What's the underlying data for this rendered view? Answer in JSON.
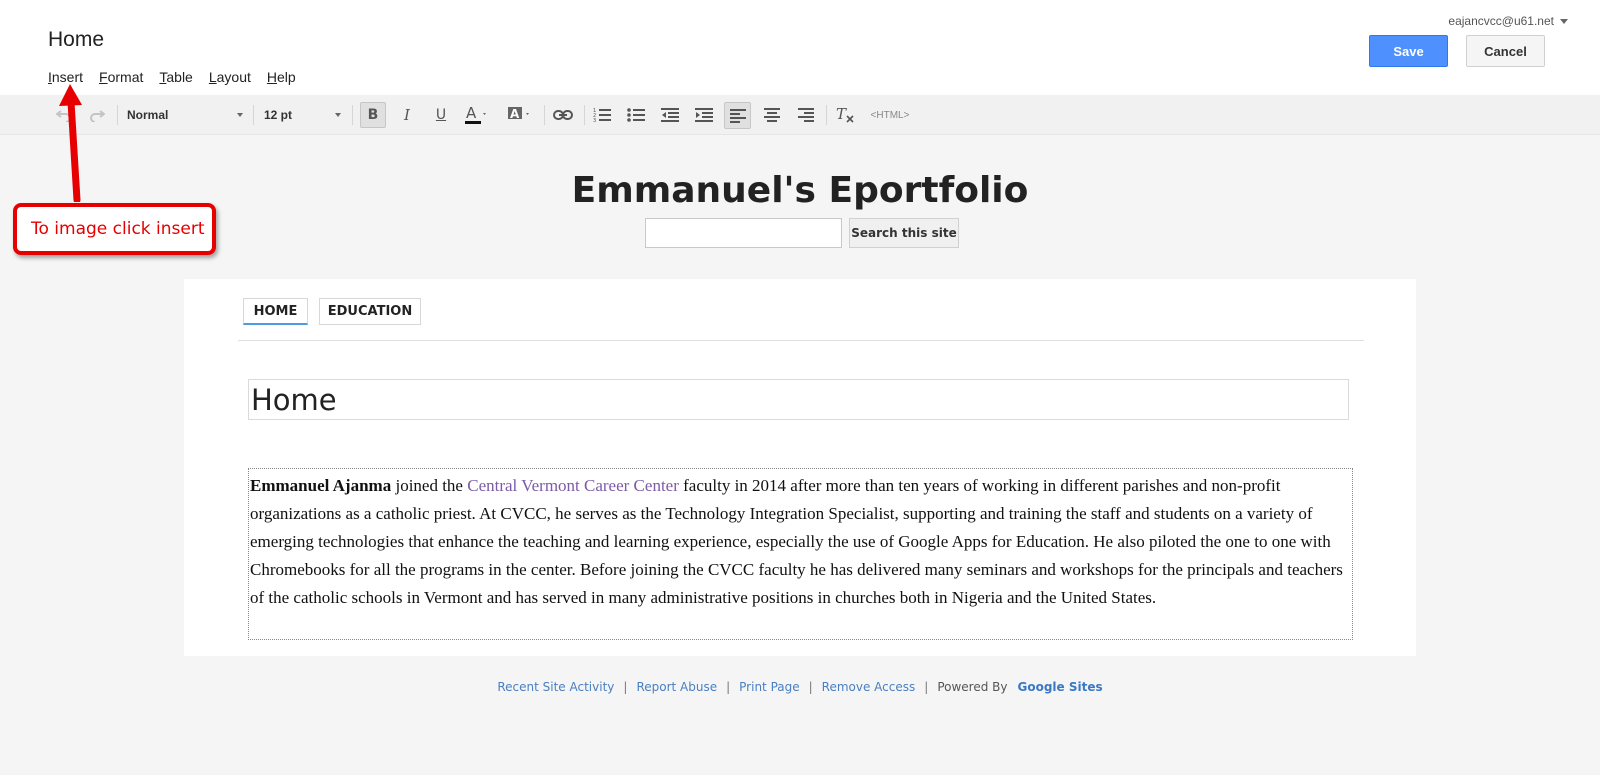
{
  "header": {
    "page_name": "Home",
    "account": "eajancvcc@u61.net",
    "save_label": "Save",
    "cancel_label": "Cancel"
  },
  "menu": {
    "items": [
      {
        "first": "I",
        "rest": "nsert"
      },
      {
        "first": "F",
        "rest": "ormat"
      },
      {
        "first": "T",
        "rest": "able"
      },
      {
        "first": "L",
        "rest": "ayout"
      },
      {
        "first": "H",
        "rest": "elp"
      }
    ]
  },
  "toolbar": {
    "style_value": "Normal",
    "size_value": "12 pt",
    "html_label": "<HTML>"
  },
  "annotation": {
    "text": "To image click insert"
  },
  "site": {
    "title": "Emmanuel's Eportfolio",
    "search_value": "",
    "search_button": "Search this site"
  },
  "nav": {
    "tabs": [
      "HOME",
      "EDUCATION"
    ]
  },
  "content": {
    "title": "Home",
    "author_name": "Emmanuel Ajanma",
    "text_1": " joined the ",
    "link_text": "Central Vermont Career Center",
    "text_2": " faculty in 2014 after more than ten years of working in different parishes and non-profit organizations as a catholic priest. At CVCC, he serves as the Technology Integration Specialist, supporting and training the staff and students on a variety of emerging technologies that enhance the teaching and learning experience, especially the use of Google Apps for Education. He also piloted the one to one with Chromebooks for all the programs in the center. Before joining the CVCC faculty he has delivered many seminars and workshops for the principals and teachers of the catholic schools in Vermont and has served in many administrative positions in churches both in Nigeria and the United States."
  },
  "footer": {
    "links": [
      "Recent Site Activity",
      "Report Abuse",
      "Print Page",
      "Remove Access"
    ],
    "powered_by": "Powered By",
    "brand": "Google Sites"
  },
  "colors": {
    "save_blue": "#4d90fe",
    "annotation_red": "#e60000",
    "link_purple": "#7b5aa6",
    "footer_link": "#4a7fc1"
  }
}
